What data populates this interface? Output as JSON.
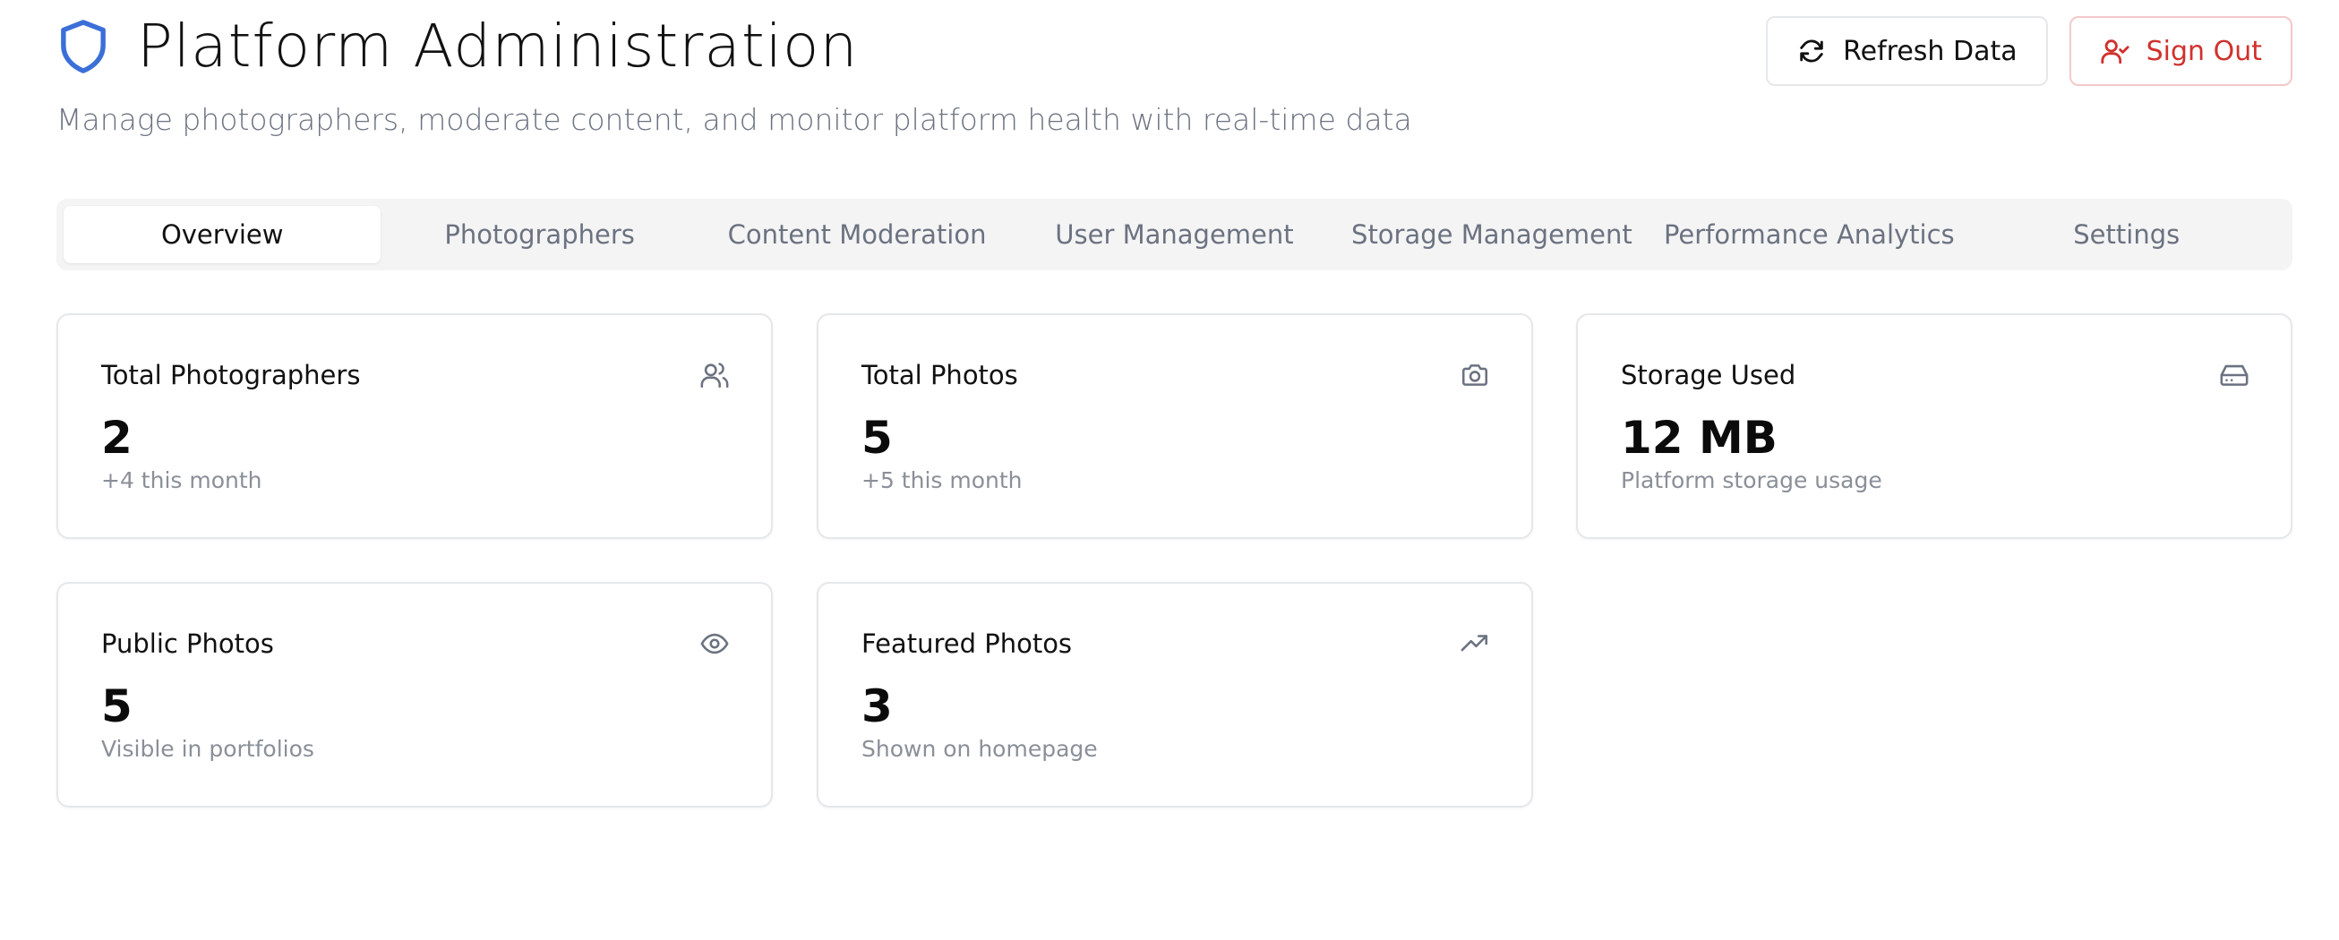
{
  "header": {
    "title": "Platform Administration",
    "subtitle": "Manage photographers, moderate content, and monitor platform health with real-time data",
    "icon": "shield-icon",
    "accent_color": "#3b6fd8"
  },
  "actions": {
    "refresh_label": "Refresh Data",
    "refresh_icon": "refresh-icon",
    "signout_label": "Sign Out",
    "signout_icon": "user-check-icon",
    "signout_color": "#d0312d"
  },
  "tabs": [
    {
      "label": "Overview",
      "active": true
    },
    {
      "label": "Photographers",
      "active": false
    },
    {
      "label": "Content Moderation",
      "active": false
    },
    {
      "label": "User Management",
      "active": false
    },
    {
      "label": "Storage Management",
      "active": false
    },
    {
      "label": "Performance Analytics",
      "active": false
    },
    {
      "label": "Settings",
      "active": false
    }
  ],
  "cards": [
    {
      "label": "Total Photographers",
      "value": "2",
      "sub": "+4 this month",
      "icon": "users-icon"
    },
    {
      "label": "Total Photos",
      "value": "5",
      "sub": "+5 this month",
      "icon": "camera-icon"
    },
    {
      "label": "Storage Used",
      "value": "12 MB",
      "sub": "Platform storage usage",
      "icon": "hard-drive-icon"
    },
    {
      "label": "Public Photos",
      "value": "5",
      "sub": "Visible in portfolios",
      "icon": "eye-icon"
    },
    {
      "label": "Featured Photos",
      "value": "3",
      "sub": "Shown on homepage",
      "icon": "trending-up-icon"
    }
  ]
}
